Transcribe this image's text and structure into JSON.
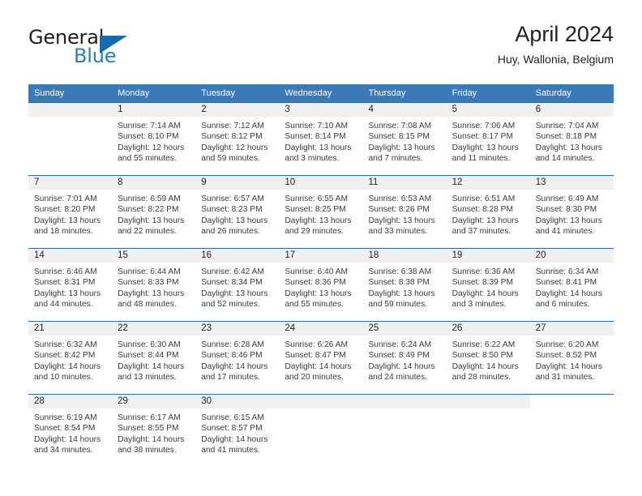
{
  "brand": {
    "name_top": "General",
    "name_bottom": "Blue",
    "triangle_color": "#1769b0",
    "blue_color": "#2b7cc4"
  },
  "header": {
    "title": "April 2024",
    "location": "Huy, Wallonia, Belgium"
  },
  "colors": {
    "header_blue": "#3a7ab8",
    "row_border_blue": "#2d6ca8",
    "day_band_gray": "#f0f0f0",
    "text": "#231f20"
  },
  "weekdays": [
    "Sunday",
    "Monday",
    "Tuesday",
    "Wednesday",
    "Thursday",
    "Friday",
    "Saturday"
  ],
  "weeks": [
    [
      {
        "day": "",
        "sunrise": "",
        "sunset": "",
        "daylight_1": "",
        "daylight_2": "",
        "empty": true
      },
      {
        "day": "1",
        "sunrise": "Sunrise: 7:14 AM",
        "sunset": "Sunset: 8:10 PM",
        "daylight_1": "Daylight: 12 hours",
        "daylight_2": "and 55 minutes."
      },
      {
        "day": "2",
        "sunrise": "Sunrise: 7:12 AM",
        "sunset": "Sunset: 8:12 PM",
        "daylight_1": "Daylight: 12 hours",
        "daylight_2": "and 59 minutes."
      },
      {
        "day": "3",
        "sunrise": "Sunrise: 7:10 AM",
        "sunset": "Sunset: 8:14 PM",
        "daylight_1": "Daylight: 13 hours",
        "daylight_2": "and 3 minutes."
      },
      {
        "day": "4",
        "sunrise": "Sunrise: 7:08 AM",
        "sunset": "Sunset: 8:15 PM",
        "daylight_1": "Daylight: 13 hours",
        "daylight_2": "and 7 minutes."
      },
      {
        "day": "5",
        "sunrise": "Sunrise: 7:06 AM",
        "sunset": "Sunset: 8:17 PM",
        "daylight_1": "Daylight: 13 hours",
        "daylight_2": "and 11 minutes."
      },
      {
        "day": "6",
        "sunrise": "Sunrise: 7:04 AM",
        "sunset": "Sunset: 8:18 PM",
        "daylight_1": "Daylight: 13 hours",
        "daylight_2": "and 14 minutes."
      }
    ],
    [
      {
        "day": "7",
        "sunrise": "Sunrise: 7:01 AM",
        "sunset": "Sunset: 8:20 PM",
        "daylight_1": "Daylight: 13 hours",
        "daylight_2": "and 18 minutes."
      },
      {
        "day": "8",
        "sunrise": "Sunrise: 6:59 AM",
        "sunset": "Sunset: 8:22 PM",
        "daylight_1": "Daylight: 13 hours",
        "daylight_2": "and 22 minutes."
      },
      {
        "day": "9",
        "sunrise": "Sunrise: 6:57 AM",
        "sunset": "Sunset: 8:23 PM",
        "daylight_1": "Daylight: 13 hours",
        "daylight_2": "and 26 minutes."
      },
      {
        "day": "10",
        "sunrise": "Sunrise: 6:55 AM",
        "sunset": "Sunset: 8:25 PM",
        "daylight_1": "Daylight: 13 hours",
        "daylight_2": "and 29 minutes."
      },
      {
        "day": "11",
        "sunrise": "Sunrise: 6:53 AM",
        "sunset": "Sunset: 8:26 PM",
        "daylight_1": "Daylight: 13 hours",
        "daylight_2": "and 33 minutes."
      },
      {
        "day": "12",
        "sunrise": "Sunrise: 6:51 AM",
        "sunset": "Sunset: 8:28 PM",
        "daylight_1": "Daylight: 13 hours",
        "daylight_2": "and 37 minutes."
      },
      {
        "day": "13",
        "sunrise": "Sunrise: 6:49 AM",
        "sunset": "Sunset: 8:30 PM",
        "daylight_1": "Daylight: 13 hours",
        "daylight_2": "and 41 minutes."
      }
    ],
    [
      {
        "day": "14",
        "sunrise": "Sunrise: 6:46 AM",
        "sunset": "Sunset: 8:31 PM",
        "daylight_1": "Daylight: 13 hours",
        "daylight_2": "and 44 minutes."
      },
      {
        "day": "15",
        "sunrise": "Sunrise: 6:44 AM",
        "sunset": "Sunset: 8:33 PM",
        "daylight_1": "Daylight: 13 hours",
        "daylight_2": "and 48 minutes."
      },
      {
        "day": "16",
        "sunrise": "Sunrise: 6:42 AM",
        "sunset": "Sunset: 8:34 PM",
        "daylight_1": "Daylight: 13 hours",
        "daylight_2": "and 52 minutes."
      },
      {
        "day": "17",
        "sunrise": "Sunrise: 6:40 AM",
        "sunset": "Sunset: 8:36 PM",
        "daylight_1": "Daylight: 13 hours",
        "daylight_2": "and 55 minutes."
      },
      {
        "day": "18",
        "sunrise": "Sunrise: 6:38 AM",
        "sunset": "Sunset: 8:38 PM",
        "daylight_1": "Daylight: 13 hours",
        "daylight_2": "and 59 minutes."
      },
      {
        "day": "19",
        "sunrise": "Sunrise: 6:36 AM",
        "sunset": "Sunset: 8:39 PM",
        "daylight_1": "Daylight: 14 hours",
        "daylight_2": "and 3 minutes."
      },
      {
        "day": "20",
        "sunrise": "Sunrise: 6:34 AM",
        "sunset": "Sunset: 8:41 PM",
        "daylight_1": "Daylight: 14 hours",
        "daylight_2": "and 6 minutes."
      }
    ],
    [
      {
        "day": "21",
        "sunrise": "Sunrise: 6:32 AM",
        "sunset": "Sunset: 8:42 PM",
        "daylight_1": "Daylight: 14 hours",
        "daylight_2": "and 10 minutes."
      },
      {
        "day": "22",
        "sunrise": "Sunrise: 6:30 AM",
        "sunset": "Sunset: 8:44 PM",
        "daylight_1": "Daylight: 14 hours",
        "daylight_2": "and 13 minutes."
      },
      {
        "day": "23",
        "sunrise": "Sunrise: 6:28 AM",
        "sunset": "Sunset: 8:46 PM",
        "daylight_1": "Daylight: 14 hours",
        "daylight_2": "and 17 minutes."
      },
      {
        "day": "24",
        "sunrise": "Sunrise: 6:26 AM",
        "sunset": "Sunset: 8:47 PM",
        "daylight_1": "Daylight: 14 hours",
        "daylight_2": "and 20 minutes."
      },
      {
        "day": "25",
        "sunrise": "Sunrise: 6:24 AM",
        "sunset": "Sunset: 8:49 PM",
        "daylight_1": "Daylight: 14 hours",
        "daylight_2": "and 24 minutes."
      },
      {
        "day": "26",
        "sunrise": "Sunrise: 6:22 AM",
        "sunset": "Sunset: 8:50 PM",
        "daylight_1": "Daylight: 14 hours",
        "daylight_2": "and 28 minutes."
      },
      {
        "day": "27",
        "sunrise": "Sunrise: 6:20 AM",
        "sunset": "Sunset: 8:52 PM",
        "daylight_1": "Daylight: 14 hours",
        "daylight_2": "and 31 minutes."
      }
    ],
    [
      {
        "day": "28",
        "sunrise": "Sunrise: 6:19 AM",
        "sunset": "Sunset: 8:54 PM",
        "daylight_1": "Daylight: 14 hours",
        "daylight_2": "and 34 minutes."
      },
      {
        "day": "29",
        "sunrise": "Sunrise: 6:17 AM",
        "sunset": "Sunset: 8:55 PM",
        "daylight_1": "Daylight: 14 hours",
        "daylight_2": "and 38 minutes."
      },
      {
        "day": "30",
        "sunrise": "Sunrise: 6:15 AM",
        "sunset": "Sunset: 8:57 PM",
        "daylight_1": "Daylight: 14 hours",
        "daylight_2": "and 41 minutes."
      },
      {
        "day": "",
        "sunrise": "",
        "sunset": "",
        "daylight_1": "",
        "daylight_2": "",
        "empty": true
      },
      {
        "day": "",
        "sunrise": "",
        "sunset": "",
        "daylight_1": "",
        "daylight_2": "",
        "empty": true
      },
      {
        "day": "",
        "sunrise": "",
        "sunset": "",
        "daylight_1": "",
        "daylight_2": "",
        "empty": true
      },
      {
        "day": "",
        "sunrise": "",
        "sunset": "",
        "daylight_1": "",
        "daylight_2": "",
        "empty": true,
        "blank": true
      }
    ]
  ]
}
